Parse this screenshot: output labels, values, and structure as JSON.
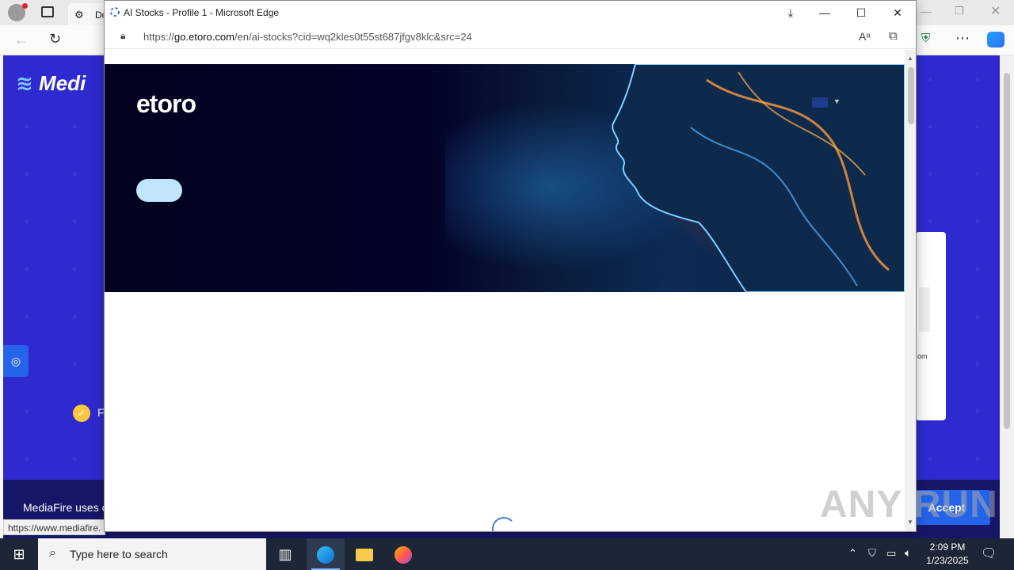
{
  "background_window": {
    "tab_label": "Do",
    "mediafire": {
      "logo": "Medi",
      "check_text": "F",
      "cookie_text": "MediaFire uses co",
      "accept_label": "Accept",
      "card_text": "om"
    },
    "status_url": "https://www.mediafire."
  },
  "popup": {
    "title": "AI Stocks - Profile 1 - Microsoft Edge",
    "url_prefix": "https://",
    "url_domain": "go.etoro.com",
    "url_rest": "/en/ai-stocks?cid=wq2kles0t55st687jfgv8klc&src=24",
    "logo": "etoro"
  },
  "watermark": "ANY RUN",
  "taskbar": {
    "search_placeholder": "Type here to search",
    "time": "2:09 PM",
    "date": "1/23/2025"
  },
  "icons": [
    "windows-start-icon",
    "search-icon",
    "task-view-icon",
    "edge-icon",
    "file-explorer-icon",
    "firefox-icon",
    "download-icon",
    "minimize-icon",
    "maximize-icon",
    "close-icon",
    "lock-icon",
    "read-aloud-icon",
    "immersive-reader-icon",
    "flag-uk-icon",
    "chevron-up-icon",
    "network-icon",
    "volume-icon",
    "notification-icon"
  ],
  "colors": {
    "mediafire_bg": "#2f2ad0",
    "etoro_hero_bg": "#02011e",
    "hero_button": "#bfe4fb",
    "taskbar": "#1c2636"
  }
}
